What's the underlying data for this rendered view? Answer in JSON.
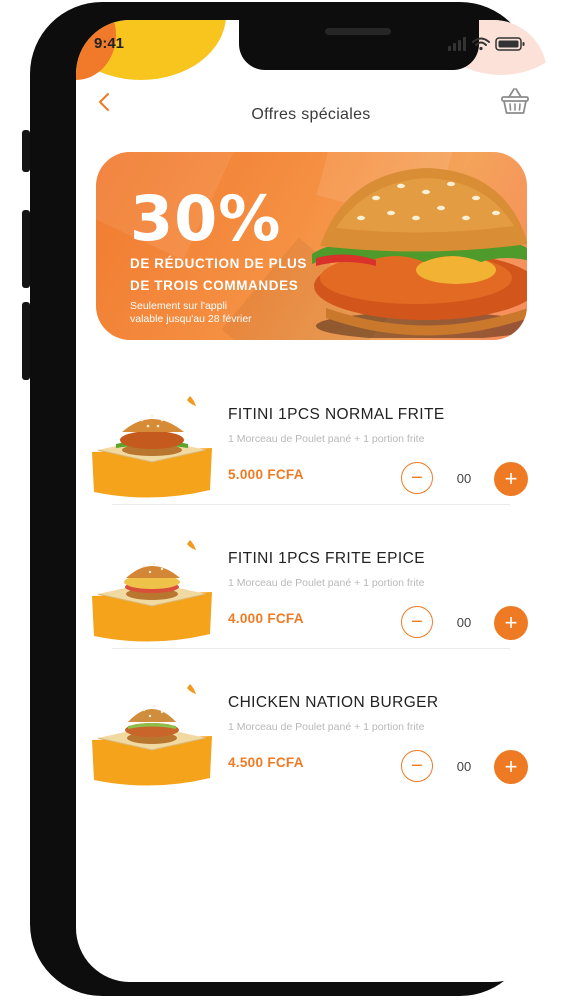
{
  "status_bar": {
    "time": "9:41"
  },
  "header": {
    "title": "Offres spéciales"
  },
  "promo": {
    "percent": "30%",
    "line1": "DE RÉDUCTION DE PLUS",
    "line2": "DE TROIS  COMMANDES",
    "line3": "Seulement sur l'appli",
    "line4": "valable jusqu'au 28 février"
  },
  "products": [
    {
      "name": "FITINI 1PCS NORMAL FRITE",
      "description": "1 Morceau de Poulet pané + 1 portion frite",
      "price": "5.000 FCFA",
      "quantity": "00"
    },
    {
      "name": "FITINI 1PCS FRITE EPICE",
      "description": "1 Morceau de Poulet pané + 1 portion frite",
      "price": "4.000 FCFA",
      "quantity": "00"
    },
    {
      "name": "CHICKEN NATION BURGER",
      "description": "1 Morceau de Poulet pané + 1 portion frite",
      "price": "4.500 FCFA",
      "quantity": "00"
    }
  ],
  "colors": {
    "accent": "#ef7a24",
    "banner": "#f4843a",
    "yellow": "#f7c51e"
  },
  "icons": {
    "back": "chevron-left-icon",
    "cart": "basket-icon",
    "minus": "minus-icon",
    "plus": "plus-icon"
  }
}
